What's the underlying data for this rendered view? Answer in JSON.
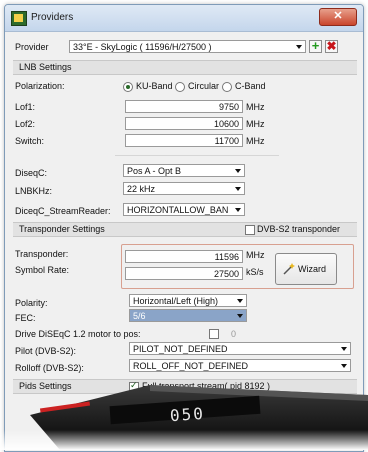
{
  "window": {
    "title": "Providers",
    "close_label": "✕"
  },
  "provider": {
    "label": "Provider",
    "value": "33°E - SkyLogic ( 11596/H/27500 )"
  },
  "sections": {
    "lnb": "LNB Settings",
    "transponder": "Transponder Settings",
    "pids": "Pids Settings"
  },
  "lnb": {
    "polarization_label": "Polarization:",
    "bands": [
      "KU-Band",
      "Circular",
      "C-Band"
    ],
    "lof1_label": "Lof1:",
    "lof1_value": "9750",
    "lof2_label": "Lof2:",
    "lof2_value": "10600",
    "switch_label": "Switch:",
    "switch_value": "11700",
    "unit": "MHz",
    "diseqc_label": "DiseqC:",
    "diseqc_value": "Pos A - Opt B",
    "lnbkhz_label": "LNBKHz:",
    "lnbkhz_value": "22 kHz",
    "streamreader_label": "DiceqC_StreamReader:",
    "streamreader_value": "HORIZONTALLOW_BAN"
  },
  "transponder": {
    "dvbs2_label": "DVB-S2 transponder",
    "transponder_label": "Transponder:",
    "transponder_value": "11596",
    "transponder_unit": "MHz",
    "symbol_label": "Symbol Rate:",
    "symbol_value": "27500",
    "symbol_unit": "kS/s",
    "wizard_label": "Wizard",
    "polarity_label": "Polarity:",
    "polarity_value": "Horizontal/Left (High)",
    "fec_label": "FEC:",
    "fec_value": "5/6",
    "motor_label": "Drive DiSEqC 1.2 motor to pos:",
    "motor_value": "0",
    "pilot_label": "Pilot (DVB-S2):",
    "pilot_value": "PILOT_NOT_DEFINED",
    "rolloff_label": "Rolloff (DVB-S2):",
    "rolloff_value": "ROLL_OFF_NOT_DEFINED"
  },
  "pids": {
    "full_ts_label": "Full transport stream( pid 8192 )"
  },
  "device": {
    "display_text": "050"
  },
  "colors": {
    "accent": "#2a6a2a",
    "close": "#c9452c",
    "fec_highlight": "#8aa4c8"
  }
}
